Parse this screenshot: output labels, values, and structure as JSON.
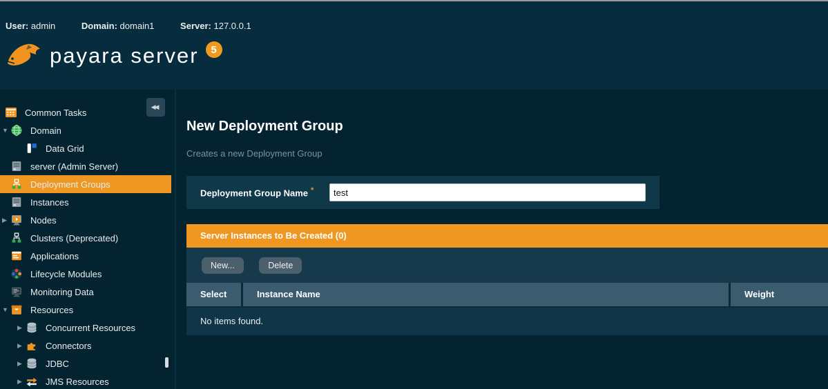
{
  "topbar": {
    "user_label": "User:",
    "user_value": "admin",
    "domain_label": "Domain:",
    "domain_value": "domain1",
    "server_label": "Server:",
    "server_value": "127.0.0.1"
  },
  "brand": {
    "name": "payara server",
    "version": "5"
  },
  "sidebar": {
    "items": [
      {
        "label": "Common Tasks"
      },
      {
        "label": "Domain"
      },
      {
        "label": "Data Grid"
      },
      {
        "label": "server (Admin Server)"
      },
      {
        "label": "Deployment Groups"
      },
      {
        "label": "Instances"
      },
      {
        "label": "Nodes"
      },
      {
        "label": "Clusters (Deprecated)"
      },
      {
        "label": "Applications"
      },
      {
        "label": "Lifecycle Modules"
      },
      {
        "label": "Monitoring Data"
      },
      {
        "label": "Resources"
      },
      {
        "label": "Concurrent Resources"
      },
      {
        "label": "Connectors"
      },
      {
        "label": "JDBC"
      },
      {
        "label": "JMS Resources"
      }
    ]
  },
  "main": {
    "title": "New Deployment Group",
    "subtitle": "Creates a new Deployment Group",
    "form": {
      "name_label": "Deployment Group Name",
      "required_marker": "*",
      "name_value": "test"
    },
    "section": {
      "header": "Server Instances to Be Created (0)",
      "new_button": "New...",
      "delete_button": "Delete"
    },
    "table": {
      "columns": [
        "Select",
        "Instance Name",
        "Weight"
      ],
      "empty_text": "No items found."
    }
  },
  "icons": {
    "collapse": "◀◀",
    "expanded_arrow": "▼",
    "collapsed_arrow": "▶"
  },
  "colors": {
    "accent_orange": "#EF9721",
    "header_bg": "#062C3E",
    "page_bg": "#032330",
    "form_row_bg": "#0F3849",
    "section_bg": "#16394B",
    "table_header_bg": "#3A5C6E",
    "empty_row_bg": "#103448",
    "button_bg": "#4B5F6C"
  }
}
